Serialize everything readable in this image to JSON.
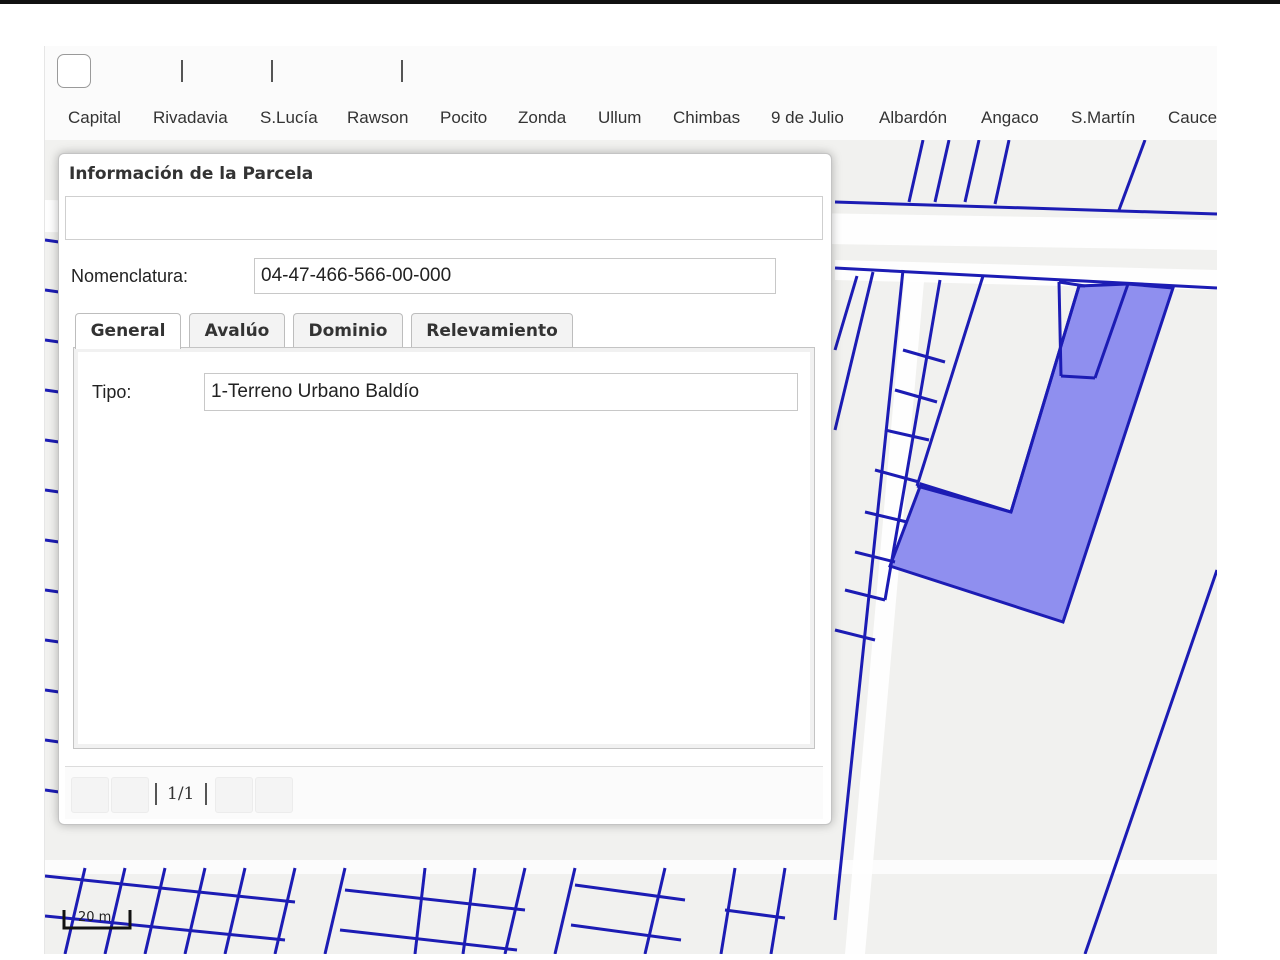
{
  "toolbar": {
    "tool_button": "tool-button"
  },
  "departments": [
    "Capital",
    "Rivadavia",
    "S.Lucía",
    "Rawson",
    "Pocito",
    "Zonda",
    "Ullum",
    "Chimbas",
    "9 de Julio",
    "Albardón",
    "Angaco",
    "S.Martín",
    "Cauce"
  ],
  "panel": {
    "title": "Información de la Parcela",
    "nomenclatura_label": "Nomenclatura:",
    "nomenclatura_value": "04-47-466-566-00-000",
    "tabs": [
      {
        "label": "General",
        "active": true
      },
      {
        "label": "Avalúo",
        "active": false
      },
      {
        "label": "Dominio",
        "active": false
      },
      {
        "label": "Relevamiento",
        "active": false
      }
    ],
    "general": {
      "tipo_label": "Tipo:",
      "tipo_value": "1-Terreno Urbano Baldío"
    },
    "pagination": "1/1"
  },
  "map": {
    "scale_label": "20 m",
    "parcel_line_color": "#1c1cb4",
    "highlight_color": "#8f8fef"
  }
}
